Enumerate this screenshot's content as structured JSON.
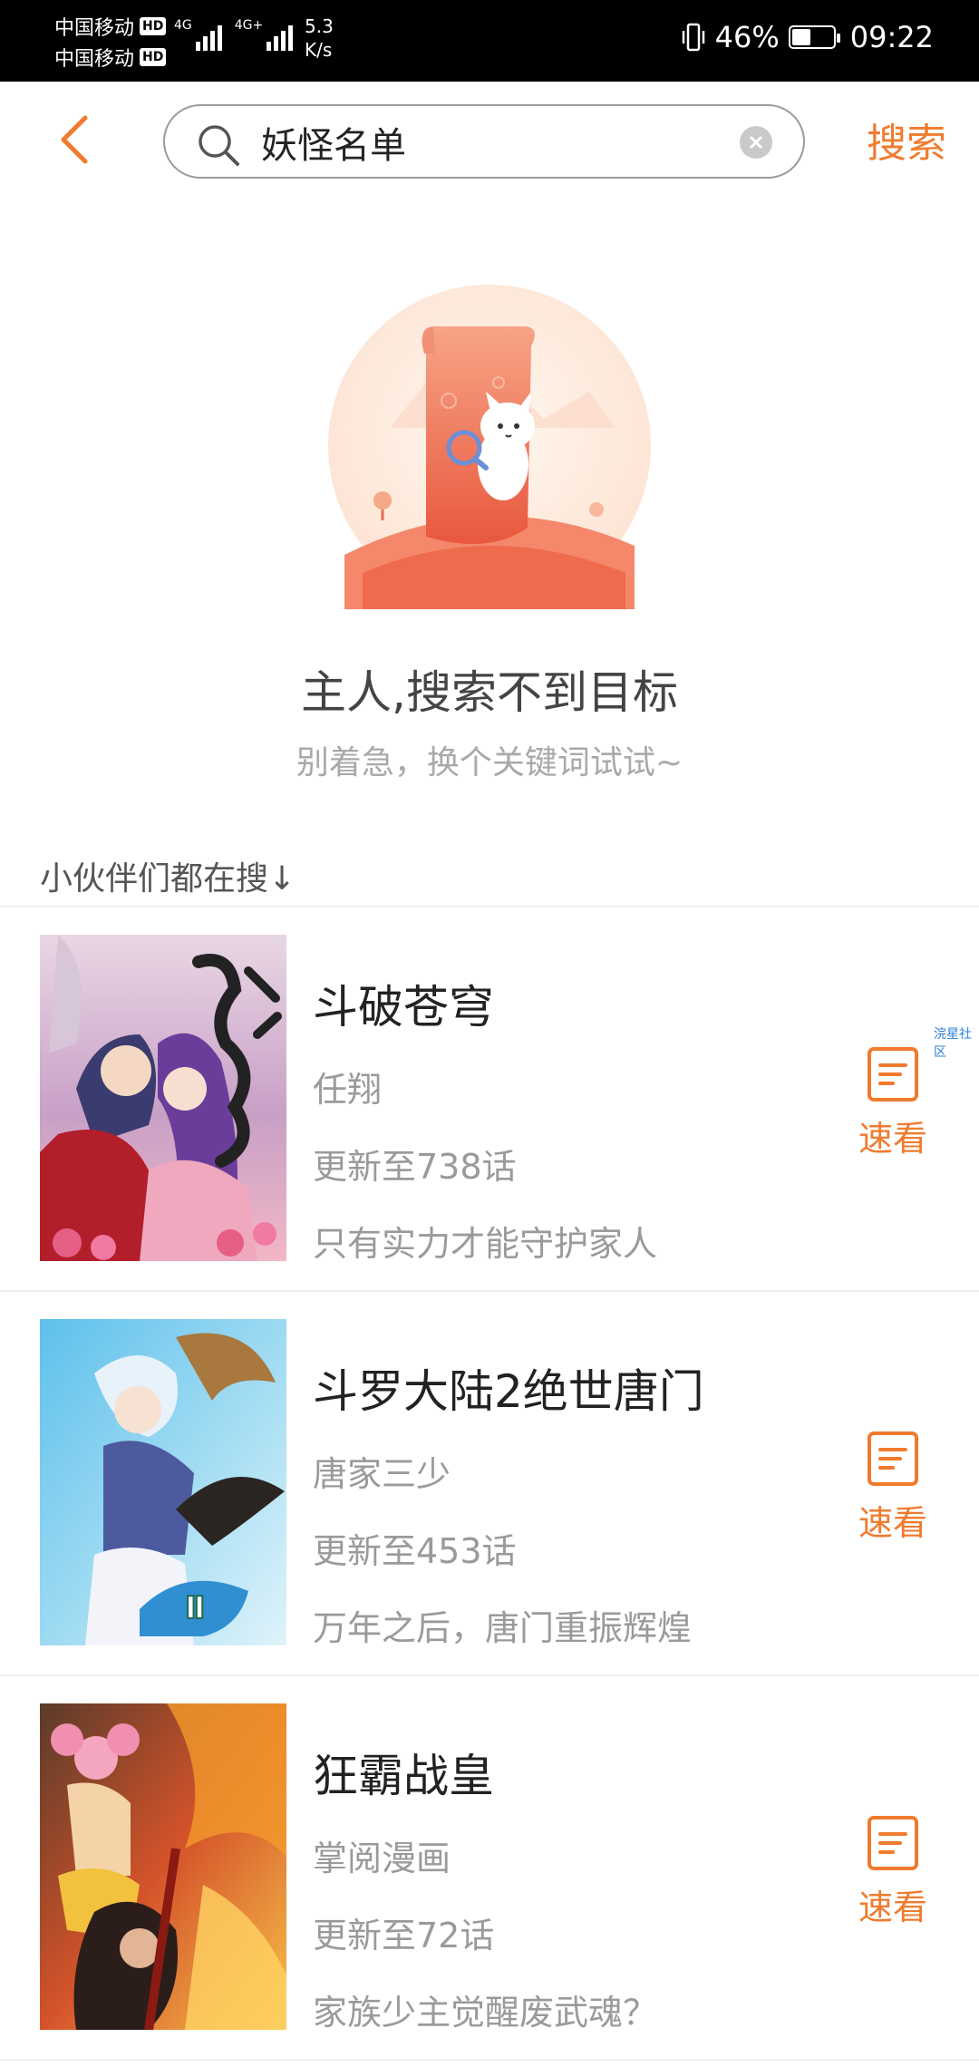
{
  "status_bar": {
    "carrier_1": "中国移动",
    "carrier_2": "中国移动",
    "hd_label": "HD",
    "net_1": "4G",
    "net_2": "4G+",
    "speed_value": "5.3",
    "speed_unit": "K/s",
    "battery_percent": "46%",
    "battery_level": 0.46,
    "time": "09:22"
  },
  "header": {
    "back_icon": "chevron-left-icon",
    "search_icon": "search-icon",
    "search_value": "妖怪名单",
    "clear_icon": "clear-icon",
    "search_button": "搜索"
  },
  "empty_state": {
    "title": "主人,搜索不到目标",
    "subtitle": "别着急，换个关键词试试~"
  },
  "section": {
    "title": "小伙伴们都在搜↓"
  },
  "list": [
    {
      "title": "斗破苍穹",
      "author": "任翔",
      "update": "更新至738话",
      "desc": "只有实力才能守护家人",
      "action": "速看"
    },
    {
      "title": "斗罗大陆2绝世唐门",
      "author": "唐家三少",
      "update": "更新至453话",
      "desc": "万年之后，唐门重振辉煌",
      "action": "速看"
    },
    {
      "title": "狂霸战皇",
      "author": "掌阅漫画",
      "update": "更新至72话",
      "desc": "家族少主觉醒废武魂？",
      "action": "速看"
    }
  ],
  "watermark": "浣星社区",
  "colors": {
    "accent": "#f07b2e",
    "title_text": "#222222",
    "secondary_text": "#9a9a9a",
    "divider": "#eeeeee"
  }
}
